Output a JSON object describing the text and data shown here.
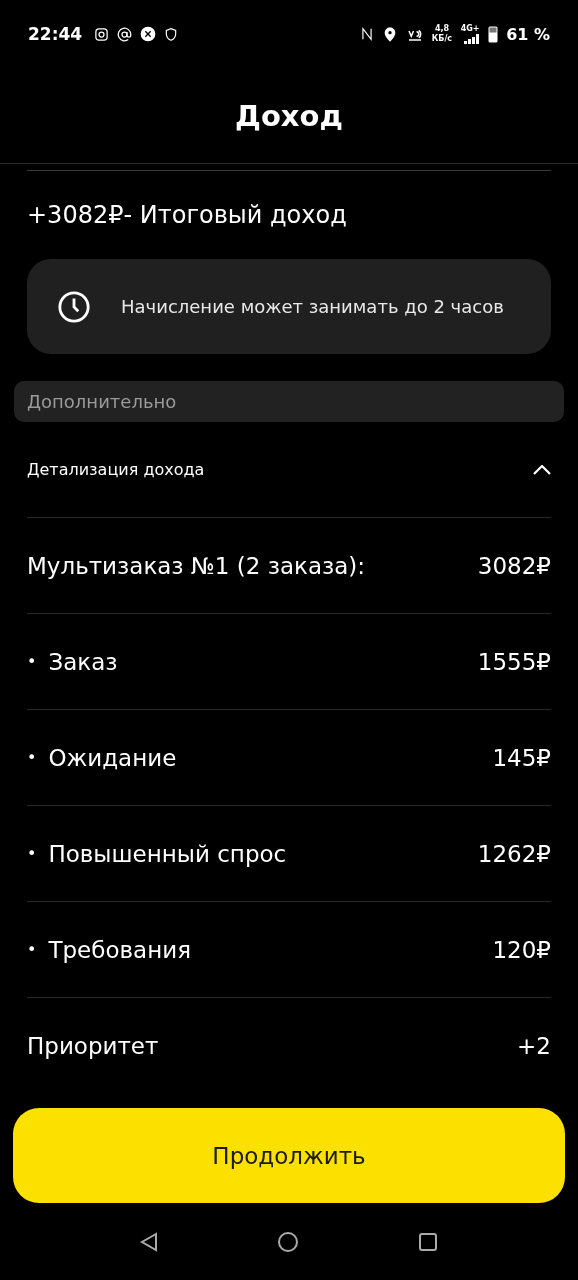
{
  "status_bar": {
    "time": "22:44",
    "speed": "4,8",
    "speed_unit": "КБ/с",
    "network": "4G+",
    "battery": "61 %"
  },
  "header": {
    "title": "Доход"
  },
  "total": {
    "amount": "+3082₽",
    "label": "- Итоговый доход"
  },
  "notice": {
    "text": "Начисление может занимать до 2 часов"
  },
  "section": {
    "title": "Дополнительно"
  },
  "details": {
    "title": "Детализация дохода",
    "expanded": true,
    "rows": [
      {
        "kind": "total",
        "label": "Мультизаказ №1 (2 заказа):",
        "value": "3082₽"
      },
      {
        "kind": "item",
        "bullet": "•",
        "label": "Заказ",
        "value": "1555₽"
      },
      {
        "kind": "item",
        "bullet": "•",
        "label": "Ожидание",
        "value": "145₽"
      },
      {
        "kind": "item",
        "bullet": "•",
        "label": "Повышенный спрос",
        "value": "1262₽"
      },
      {
        "kind": "item",
        "bullet": "•",
        "label": "Требования",
        "value": "120₽"
      },
      {
        "kind": "total",
        "label": "Приоритет",
        "value": "+2"
      }
    ]
  },
  "button": {
    "label": "Продолжить"
  }
}
